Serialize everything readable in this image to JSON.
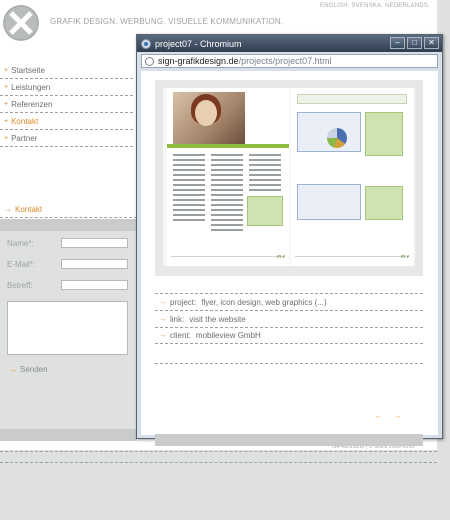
{
  "site": {
    "tagline": "GRAFIK DESIGN. WERBUNG. VISUELLE KOMMUNIKATION.",
    "languages": "ENGLISH. SVENSKA. NEDERLANDS.",
    "nav": [
      {
        "label": "Startseite",
        "active": false
      },
      {
        "label": "Leistungen",
        "active": false
      },
      {
        "label": "Referenzen",
        "active": false
      },
      {
        "label": "Kontakt",
        "active": true
      },
      {
        "label": "Partner",
        "active": false
      }
    ],
    "contact": {
      "heading": "Kontakt",
      "name_label": "Name*:",
      "email_label": "E-Mail*:",
      "subject_label": "Betreff:",
      "send_label": "Senden"
    },
    "footer": "IMPRESSUM | © SIGN 2000-2010",
    "accent_color": "#e08a2c"
  },
  "popup": {
    "title": "project07 - Chromium",
    "url_domain": "sign-grafikdesign.de",
    "url_path": "/projects/project07.html",
    "buttons": {
      "minimize": "–",
      "maximize": "□",
      "close": "✕"
    },
    "project": {
      "project_key": "project:",
      "project_value": "flyer, icon design, web graphics (...)",
      "link_key": "link:",
      "link_value": "visit the website",
      "client_key": "client:",
      "client_value": "mobileview GmbH"
    },
    "prev_arrow": "←",
    "next_arrow": "→"
  }
}
